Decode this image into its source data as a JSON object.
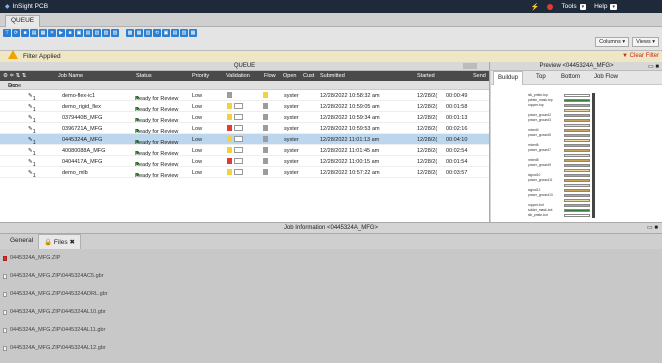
{
  "app": {
    "title": "InSight PCB",
    "tools_label": "Tools",
    "help_label": "Help"
  },
  "tabs": {
    "active": "QUEUE"
  },
  "toolbar": {
    "columns_label": "Columns",
    "views_label": "Views"
  },
  "filter": {
    "label": "Filter Applied",
    "clear_label": "Clear Filter"
  },
  "queue": {
    "title": "QUEUE",
    "columns": [
      "Job Name",
      "Status",
      "Priority",
      "Validation",
      "Flow",
      "Open",
      "Cust",
      "Submitted",
      "Started",
      "Send"
    ],
    "group_label": "Done",
    "rows": [
      {
        "rev": "1",
        "name": "demo-flex-ic1",
        "status": "Ready for Review",
        "priority": "Low",
        "validation": "gray",
        "open": "syster",
        "submitted": "12/28/2022 10:58:32 am",
        "started": "12/28/2(",
        "dur": "00:00:49",
        "selected": false
      },
      {
        "rev": "1",
        "name": "demo_rigid_flex",
        "status": "Ready for Review",
        "priority": "Low",
        "validation": "yellow",
        "open": "syster",
        "submitted": "12/28/2022 10:59:05 am",
        "started": "12/28/2(",
        "dur": "00:01:58",
        "selected": false
      },
      {
        "rev": "1",
        "name": "0379440B_MFG",
        "status": "Ready for Review",
        "priority": "Low",
        "validation": "yellow",
        "open": "syster",
        "submitted": "12/28/2022 10:59:34 am",
        "started": "12/28/2(",
        "dur": "00:01:13",
        "selected": false
      },
      {
        "rev": "1",
        "name": "0396721A_MFG",
        "status": "Ready for Review",
        "priority": "Low",
        "validation": "red",
        "open": "syster",
        "submitted": "12/28/2022 10:59:53 am",
        "started": "12/28/2(",
        "dur": "00:02:16",
        "selected": false
      },
      {
        "rev": "1",
        "name": "0445324A_MFG",
        "status": "Ready for Review",
        "priority": "Low",
        "validation": "yellow",
        "open": "syster",
        "submitted": "12/28/2022 11:01:13 am",
        "started": "12/28/2(",
        "dur": "00:04:10",
        "selected": true
      },
      {
        "rev": "1",
        "name": "40080088A_MFG",
        "status": "Ready for Review",
        "priority": "Low",
        "validation": "yellow",
        "open": "syster",
        "submitted": "12/28/2022 11:01:45 am",
        "started": "12/28/2(",
        "dur": "00:02:54",
        "selected": false
      },
      {
        "rev": "1",
        "name": "0404417A_MFG",
        "status": "Ready for Review",
        "priority": "Low",
        "validation": "red",
        "open": "syster",
        "submitted": "12/28/2022 11:00:15 am",
        "started": "12/28/2(",
        "dur": "00:01:54",
        "selected": false
      },
      {
        "rev": "1",
        "name": "demo_mlb",
        "status": "Ready for Review",
        "priority": "Low",
        "validation": "yellow",
        "open": "syster",
        "submitted": "12/28/2022 10:57:22 am",
        "started": "12/28/2(",
        "dur": "00:03:57",
        "selected": false
      }
    ]
  },
  "preview": {
    "title": "Preview <0445324A_MFG>",
    "tabs": [
      "Buildup",
      "Top",
      "Bottom",
      "Job Flow"
    ],
    "layers": [
      {
        "label": "slk_prtstn-top",
        "color": "#ffffff"
      },
      {
        "label": "pdrstn_mask-top",
        "color": "#3a7d3a"
      },
      {
        "label": "copper-top",
        "color": "#c8a45a"
      },
      {
        "label": "",
        "color": "#e8d9a8"
      },
      {
        "label": "power_ground2",
        "color": "#c8a45a"
      },
      {
        "label": "power_ground3",
        "color": "#c8a45a"
      },
      {
        "label": "",
        "color": "#e8d9a8"
      },
      {
        "label": "mixed4",
        "color": "#c8a45a"
      },
      {
        "label": "power_ground5",
        "color": "#c8a45a"
      },
      {
        "label": "",
        "color": "#e8d9a8"
      },
      {
        "label": "mixed6",
        "color": "#c8a45a"
      },
      {
        "label": "power_ground7",
        "color": "#c8a45a"
      },
      {
        "label": "",
        "color": "#e8d9a8"
      },
      {
        "label": "mixed8",
        "color": "#c8a45a"
      },
      {
        "label": "power_ground9",
        "color": "#c8a45a"
      },
      {
        "label": "",
        "color": "#e8d9a8"
      },
      {
        "label": "signal10",
        "color": "#c8a45a"
      },
      {
        "label": "power_ground11",
        "color": "#c8a45a"
      },
      {
        "label": "",
        "color": "#e8d9a8"
      },
      {
        "label": "signal12",
        "color": "#c8a45a"
      },
      {
        "label": "power_ground13",
        "color": "#c8a45a"
      },
      {
        "label": "",
        "color": "#e8d9a8"
      },
      {
        "label": "copper-bot",
        "color": "#c8a45a"
      },
      {
        "label": "solder_mask-bot",
        "color": "#3a7d3a"
      },
      {
        "label": "slk_prtstn-bot",
        "color": "#ffffff"
      }
    ]
  },
  "jobinfo": {
    "title": "Job Information <0445324A_MFG>",
    "tabs": [
      "General",
      "Files"
    ],
    "files": [
      "0445324A_MFG.ZIP",
      "0445324A_MFG.ZIP\\0445324AC5.gbr",
      "0445324A_MFG.ZIP\\0445324ADRL.gbr",
      "0445324A_MFG.ZIP\\0445324AL10.gbr",
      "0445324A_MFG.ZIP\\0445324AL11.gbr",
      "0445324A_MFG.ZIP\\0445324AL12.gbr",
      "0445324A_MFG.ZIP\\0445324AL13.gbr"
    ]
  }
}
